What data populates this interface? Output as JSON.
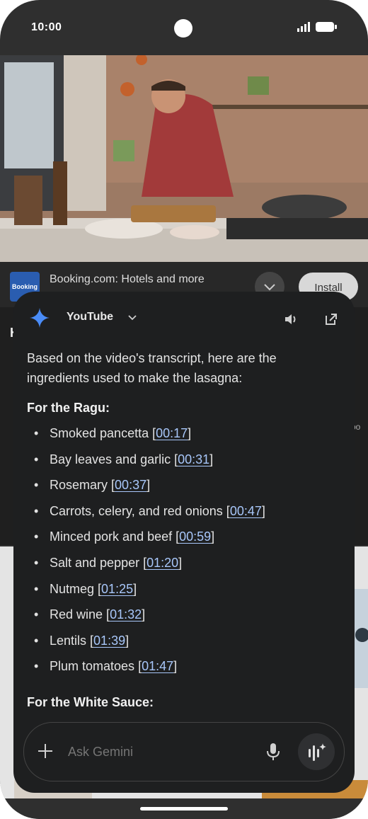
{
  "status_bar": {
    "time": "10:00"
  },
  "ad": {
    "logo_text": "Booking",
    "title": "Booking.com: Hotels and more",
    "install_label": "Install"
  },
  "peek": {
    "left_letter": "H",
    "right_fragment": "po"
  },
  "gemini_panel": {
    "source": "YouTube",
    "intro": "Based on the video's transcript, here are the ingredients used to make the lasagna:",
    "sections": [
      {
        "title": "For the Ragu:",
        "items": [
          {
            "text": "Smoked pancetta",
            "timestamp": "00:17"
          },
          {
            "text": "Bay leaves and garlic",
            "timestamp": "00:31"
          },
          {
            "text": "Rosemary",
            "timestamp": "00:37"
          },
          {
            "text": "Carrots, celery, and red onions",
            "timestamp": "00:47"
          },
          {
            "text": "Minced pork and beef",
            "timestamp": "00:59"
          },
          {
            "text": "Salt and pepper",
            "timestamp": "01:20"
          },
          {
            "text": "Nutmeg",
            "timestamp": "01:25"
          },
          {
            "text": "Red wine",
            "timestamp": "01:32"
          },
          {
            "text": "Lentils",
            "timestamp": "01:39"
          },
          {
            "text": "Plum tomatoes",
            "timestamp": "01:47"
          }
        ]
      },
      {
        "title": "For the White Sauce:",
        "items": []
      }
    ],
    "input_placeholder": "Ask Gemini"
  },
  "icons": {
    "gemini": "gemini-star-icon",
    "chevron": "chevron-down-icon",
    "speaker": "speaker-icon",
    "external": "open-external-icon",
    "plus": "plus-icon",
    "mic": "mic-icon",
    "live": "gemini-live-icon"
  },
  "colors": {
    "panel_bg": "#1e1f20",
    "link": "#a8c7fa",
    "gemini_blue": "#4a8cf7"
  }
}
